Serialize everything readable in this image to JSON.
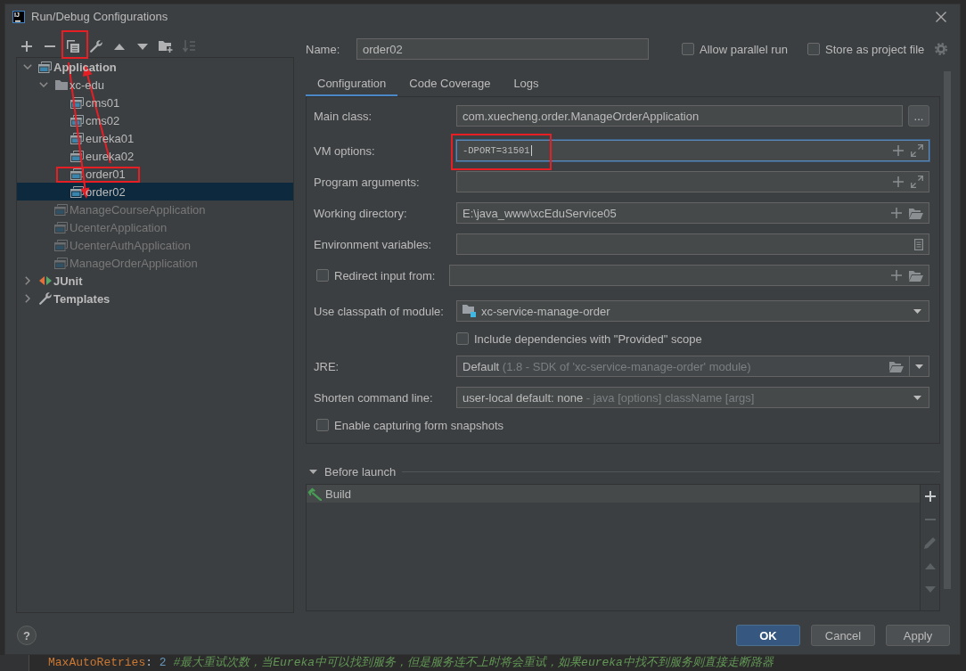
{
  "window": {
    "title": "Run/Debug Configurations",
    "logo": "IJ"
  },
  "toolbar": [
    {
      "kind": "add",
      "disabled": false
    },
    {
      "kind": "remove",
      "disabled": false
    },
    {
      "kind": "copy",
      "disabled": false
    },
    {
      "kind": "edit-defaults",
      "disabled": false
    },
    {
      "kind": "move-up",
      "disabled": false
    },
    {
      "kind": "move-down",
      "disabled": false
    },
    {
      "kind": "new-folder",
      "disabled": false
    },
    {
      "kind": "sort",
      "disabled": true
    }
  ],
  "tree": [
    {
      "label": "Application",
      "kind": "app-group",
      "expanded": true,
      "selected": false,
      "dimmed": false,
      "children": [
        {
          "label": "xc-edu",
          "kind": "folder",
          "expanded": true,
          "selected": false,
          "dimmed": false,
          "children": [
            {
              "label": "cms01",
              "kind": "config",
              "selected": false,
              "dimmed": false
            },
            {
              "label": "cms02",
              "kind": "config",
              "selected": false,
              "dimmed": false
            },
            {
              "label": "eureka01",
              "kind": "config",
              "selected": false,
              "dimmed": false
            },
            {
              "label": "eureka02",
              "kind": "config",
              "selected": false,
              "dimmed": false
            },
            {
              "label": "order01",
              "kind": "config",
              "selected": false,
              "dimmed": false
            },
            {
              "label": "order02",
              "kind": "config",
              "selected": true,
              "dimmed": false
            }
          ]
        },
        {
          "label": "ManageCourseApplication",
          "kind": "config",
          "selected": false,
          "dimmed": true
        },
        {
          "label": "UcenterApplication",
          "kind": "config",
          "selected": false,
          "dimmed": true
        },
        {
          "label": "UcenterAuthApplication",
          "kind": "config",
          "selected": false,
          "dimmed": true
        },
        {
          "label": "ManageOrderApplication",
          "kind": "config",
          "selected": false,
          "dimmed": true
        }
      ]
    },
    {
      "label": "JUnit",
      "kind": "test-group",
      "expanded": false,
      "selected": false,
      "dimmed": false
    },
    {
      "label": "Templates",
      "kind": "templates",
      "expanded": false,
      "selected": false,
      "dimmed": false
    }
  ],
  "name": {
    "label": "Name:",
    "value": "order02"
  },
  "options": [
    {
      "label": "Allow parallel run",
      "checked": false
    },
    {
      "label": "Store as project file",
      "checked": false
    }
  ],
  "tabs": [
    {
      "label": "Configuration",
      "selected": true
    },
    {
      "label": "Code Coverage",
      "selected": false
    },
    {
      "label": "Logs",
      "selected": false
    }
  ],
  "form": [
    {
      "kind": "class",
      "label": "Main class:",
      "value": "com.xuecheng.order.ManageOrderApplication",
      "focused": false,
      "button": "..."
    },
    {
      "kind": "options",
      "label": "VM options:",
      "value": "-DPORT=31501",
      "focused": true
    },
    {
      "kind": "options",
      "label": "Program arguments:",
      "focused": false
    },
    {
      "kind": "path",
      "label": "Working directory:",
      "value": "E:\\java_www\\xcEduService05",
      "focused": false
    },
    {
      "kind": "env",
      "label": "Environment variables:",
      "focused": false
    },
    {
      "kind": "redirect",
      "label": "Redirect input from:",
      "checked": false,
      "focused": false
    },
    {
      "kind": "module",
      "label": "Use classpath of module:",
      "value": "xc-service-manage-order"
    },
    {
      "kind": "option",
      "label": "Include dependencies with \"Provided\" scope",
      "checked": false
    },
    {
      "kind": "jre",
      "label": "JRE:",
      "value": "Default",
      "hint": "(1.8 - SDK of 'xc-service-manage-order' module)"
    },
    {
      "kind": "select",
      "label": "Shorten command line:",
      "value": "user-local default: none",
      "hint": "- java [options] className [args]"
    },
    {
      "kind": "checkbox",
      "label": "Enable capturing form snapshots",
      "checked": false
    }
  ],
  "before_launch": {
    "title": "Before launch",
    "expanded": true,
    "tasks": [
      {
        "label": "Build",
        "selected": true
      }
    ],
    "tools": [
      {
        "kind": "add",
        "disabled": false
      },
      {
        "kind": "remove",
        "disabled": true
      },
      {
        "kind": "edit",
        "disabled": true
      },
      {
        "kind": "move-up",
        "disabled": true
      },
      {
        "kind": "move-down",
        "disabled": true
      }
    ]
  },
  "help_button": {
    "label": "?"
  },
  "buttons": [
    {
      "label": "OK",
      "kind": "primary"
    },
    {
      "label": "Cancel",
      "kind": "secondary"
    },
    {
      "label": "Apply",
      "kind": "secondary"
    }
  ],
  "editor_behind": {
    "tokens": [
      {
        "kind": "key",
        "text": "MaxAutoRetries"
      },
      {
        "kind": "punct",
        "text": ":"
      },
      {
        "kind": "number",
        "text": "2"
      },
      {
        "kind": "comment",
        "text": "#最大重试次数，当Eureka中可以找到服务，但是服务连不上时将会重试，如果eureka中找不到服务则直接走断路器"
      }
    ]
  }
}
